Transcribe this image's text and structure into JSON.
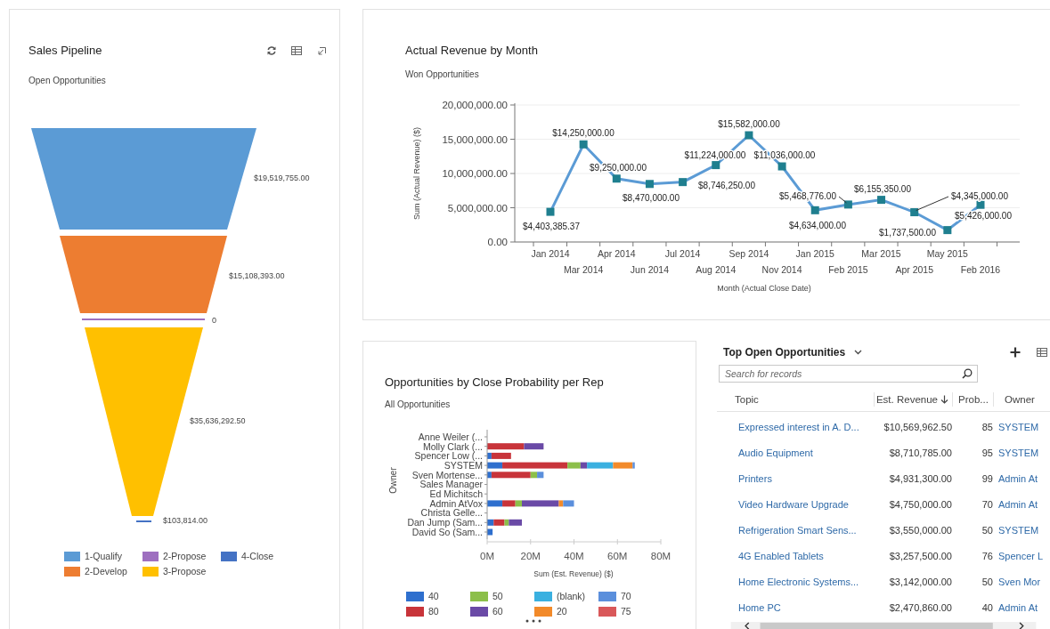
{
  "sales_pipeline": {
    "title": "Sales Pipeline",
    "subtitle": "Open Opportunities",
    "funnel": [
      {
        "kind": "band",
        "color": "#5b9bd5",
        "value_label": "$19,519,755.00"
      },
      {
        "kind": "band",
        "color": "#ed7d31",
        "value_label": "$15,108,393.00"
      },
      {
        "kind": "line",
        "color": "#9e6fc0",
        "value_label": "0"
      },
      {
        "kind": "band",
        "color": "#ffc000",
        "value_label": "$35,636,292.50"
      },
      {
        "kind": "line",
        "color": "#4472c4",
        "value_label": "$103,814.00"
      }
    ],
    "legend": [
      {
        "label": "1-Qualify",
        "color": "#5b9bd5"
      },
      {
        "label": "2-Propose",
        "color": "#9e6fc0"
      },
      {
        "label": "4-Close",
        "color": "#4472c4"
      },
      {
        "label": "2-Develop",
        "color": "#ed7d31"
      },
      {
        "label": "3-Propose",
        "color": "#ffc000"
      }
    ]
  },
  "revenue": {
    "title": "Actual Revenue by Month",
    "subtitle": "Won Opportunities",
    "chart_data": {
      "type": "line",
      "xlabel": "Month (Actual Close Date)",
      "ylabel": "Sum (Actual Revenue) ($)",
      "categories": [
        "Jan 2014",
        "Mar 2014",
        "Apr 2014",
        "Jun 2014",
        "Jul 2014",
        "Aug 2014",
        "Sep 2014",
        "Nov 2014",
        "Jan 2015",
        "Feb 2015",
        "Mar 2015",
        "Apr 2015",
        "May 2015",
        "Feb 2016"
      ],
      "grid": true,
      "series": [
        {
          "color": "#5b9bd5",
          "marker": "square",
          "values": [
            4403385.37,
            14250000,
            9250000,
            8470000,
            8746250,
            11224000,
            15582000,
            11036000,
            4634000,
            5468776,
            6155350,
            4345000,
            1737500,
            5426000
          ]
        }
      ],
      "value_labels": [
        "$4,403,385.37",
        "$14,250,000.00",
        "$9,250,000.00",
        "$8,470,000.00",
        "$8,746,250.00",
        "$11,224,000.00",
        "$15,582,000.00",
        "$11,036,000.00",
        "$4,634,000.00",
        "$5,468,776.00",
        "$6,155,350.00",
        "$4,345,000.00",
        "$1,737,500.00",
        "$5,426,000.00"
      ],
      "ylim": [
        0,
        20000000
      ],
      "yticks": [
        {
          "value": 0,
          "label": "0.00"
        },
        {
          "value": 5000000,
          "label": "5,000,000.00"
        },
        {
          "value": 10000000,
          "label": "10,000,000.00"
        },
        {
          "value": 15000000,
          "label": "15,000,000.00"
        },
        {
          "value": 20000000,
          "label": "20,000,000.00"
        }
      ]
    }
  },
  "probability": {
    "title": "Opportunities by Close Probability per Rep",
    "subtitle": "All Opportunities",
    "chart_data": {
      "type": "bar",
      "orientation": "horizontal",
      "stacked": true,
      "xlabel": "Sum (Est. Revenue) ($)",
      "ylabel": "Owner",
      "categories": [
        "Anne Weiler (...",
        "Molly Clark (...",
        "Spencer Low (...",
        "SYSTEM",
        "Sven Mortense...",
        "Sales Manager",
        "Ed Michitsch",
        "Admin AtVox",
        "Christa Gelle...",
        "Dan Jump (Sam...",
        "David So (Sam..."
      ],
      "series": [
        {
          "name": "40",
          "color": "#2e6fce",
          "values": [
            null,
            null,
            2,
            7,
            2,
            null,
            null,
            7,
            null,
            3,
            2.5
          ]
        },
        {
          "name": "80",
          "color": "#c8343a",
          "values": [
            null,
            17,
            9,
            30,
            18,
            null,
            null,
            6,
            null,
            5,
            null
          ]
        },
        {
          "name": "50",
          "color": "#8cbf4a",
          "values": [
            null,
            null,
            null,
            6,
            3,
            null,
            null,
            3,
            null,
            2,
            null
          ]
        },
        {
          "name": "60",
          "color": "#6a4aa6",
          "values": [
            null,
            9,
            null,
            3,
            null,
            null,
            null,
            17,
            null,
            6,
            null
          ]
        },
        {
          "name": "(blank)",
          "color": "#3ab0e0",
          "values": [
            null,
            null,
            null,
            12,
            null,
            null,
            null,
            null,
            null,
            null,
            null
          ]
        },
        {
          "name": "20",
          "color": "#f28a2a",
          "values": [
            null,
            null,
            null,
            9,
            null,
            null,
            null,
            2,
            null,
            null,
            null
          ]
        },
        {
          "name": "70",
          "color": "#5b8fdc",
          "values": [
            null,
            null,
            null,
            1,
            3,
            null,
            null,
            5,
            null,
            null,
            null
          ]
        },
        {
          "name": "75",
          "color": "#d9585a",
          "values": [
            null,
            null,
            null,
            null,
            null,
            null,
            null,
            null,
            null,
            null,
            null
          ]
        }
      ],
      "xlim": [
        0,
        80
      ],
      "xticks": [
        {
          "value": 0,
          "label": "0M"
        },
        {
          "value": 20,
          "label": "20M"
        },
        {
          "value": 40,
          "label": "40M"
        },
        {
          "value": 60,
          "label": "60M"
        },
        {
          "value": 80,
          "label": "80M"
        }
      ]
    }
  },
  "top_opportunities": {
    "title": "Top Open Opportunities",
    "search": {
      "placeholder": "Search for records"
    },
    "columns": [
      {
        "label": "Topic",
        "sorted": false
      },
      {
        "label": "Est. Revenue",
        "sorted": true
      },
      {
        "label": "Prob...",
        "sorted": false
      },
      {
        "label": "Owner",
        "sorted": false
      }
    ],
    "rows": [
      {
        "topic": "Expressed interest in A. D...",
        "est_revenue": "$10,569,962.50",
        "probability": "85",
        "owner": "SYSTEM"
      },
      {
        "topic": "Audio Equipment",
        "est_revenue": "$8,710,785.00",
        "probability": "95",
        "owner": "SYSTEM"
      },
      {
        "topic": "Printers",
        "est_revenue": "$4,931,300.00",
        "probability": "99",
        "owner": "Admin At"
      },
      {
        "topic": "Video Hardware Upgrade",
        "est_revenue": "$4,750,000.00",
        "probability": "70",
        "owner": "Admin At"
      },
      {
        "topic": "Refrigeration Smart Sens...",
        "est_revenue": "$3,550,000.00",
        "probability": "50",
        "owner": "SYSTEM"
      },
      {
        "topic": "4G Enabled Tablets",
        "est_revenue": "$3,257,500.00",
        "probability": "76",
        "owner": "Spencer L"
      },
      {
        "topic": "Home Electronic Systems...",
        "est_revenue": "$3,142,000.00",
        "probability": "50",
        "owner": "Sven Mor"
      },
      {
        "topic": "Home PC",
        "est_revenue": "$2,470,860.00",
        "probability": "40",
        "owner": "Admin At"
      }
    ]
  }
}
